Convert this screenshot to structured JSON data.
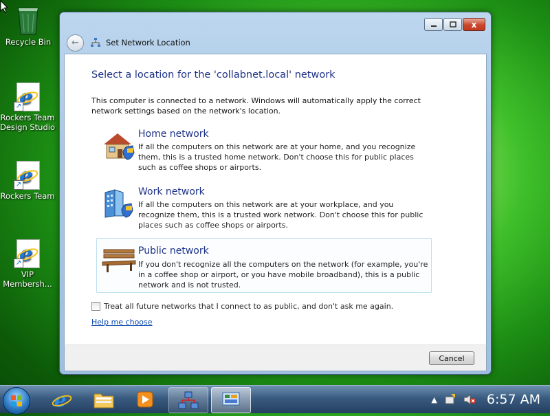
{
  "desktop": {
    "icons": [
      {
        "label": "Recycle Bin"
      },
      {
        "label": "Rockers Team Design Studio"
      },
      {
        "label": "Rockers Team"
      },
      {
        "label": "VIP Membersh..."
      }
    ]
  },
  "dialog": {
    "breadcrumb": "Set Network Location",
    "heading": "Select a location for the 'collabnet.local' network",
    "description": "This computer is connected to a network. Windows will automatically apply the correct network settings based on the network's location.",
    "options": [
      {
        "title": "Home network",
        "description": "If all the computers on this network are at your home, and you recognize them, this is a trusted home network.  Don't choose this for public places such as coffee shops or airports."
      },
      {
        "title": "Work network",
        "description": "If all the computers on this network are at your workplace, and you recognize them, this is a trusted work network.  Don't choose this for public places such as coffee shops or airports."
      },
      {
        "title": "Public network",
        "description": "If you don't recognize all the computers on the network (for example, you're in a coffee shop or airport, or you have mobile broadband), this is a public network and is not trusted."
      }
    ],
    "checkbox_label": "Treat all future networks that I connect to as public, and don't ask me again.",
    "checkbox_checked": false,
    "help_link": "Help me choose",
    "cancel_label": "Cancel",
    "close_glyph": "x"
  },
  "taskbar": {
    "clock": "6:57 AM",
    "icons": [
      "start-orb-icon",
      "internet-explorer-icon",
      "windows-explorer-icon",
      "media-player-icon",
      "network-icon",
      "control-panel-icon"
    ]
  },
  "colors": {
    "heading": "#1e3287",
    "link": "#0645ad",
    "desktop_green": "#3fbf2a"
  }
}
